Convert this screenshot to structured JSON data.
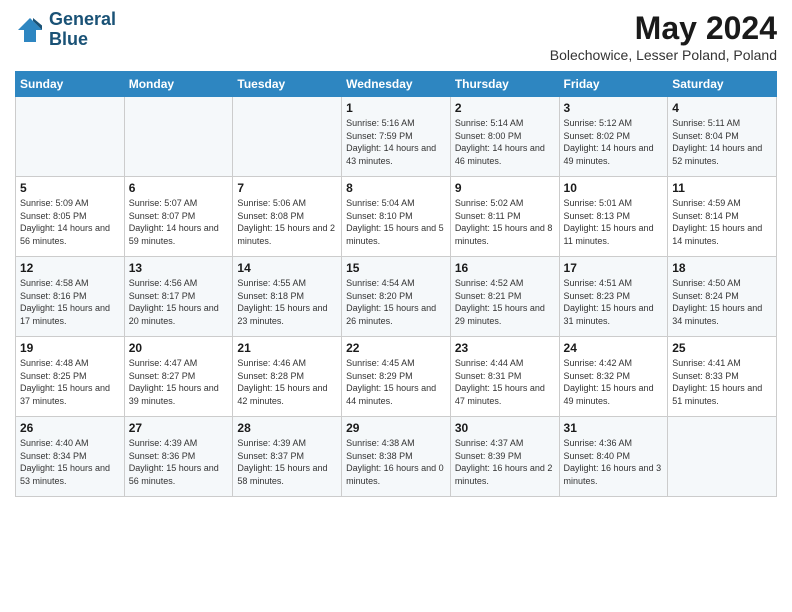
{
  "logo": {
    "line1": "General",
    "line2": "Blue"
  },
  "title": "May 2024",
  "location": "Bolechowice, Lesser Poland, Poland",
  "headers": [
    "Sunday",
    "Monday",
    "Tuesday",
    "Wednesday",
    "Thursday",
    "Friday",
    "Saturday"
  ],
  "weeks": [
    [
      {
        "day": "",
        "sunrise": "",
        "sunset": "",
        "daylight": ""
      },
      {
        "day": "",
        "sunrise": "",
        "sunset": "",
        "daylight": ""
      },
      {
        "day": "",
        "sunrise": "",
        "sunset": "",
        "daylight": ""
      },
      {
        "day": "1",
        "sunrise": "Sunrise: 5:16 AM",
        "sunset": "Sunset: 7:59 PM",
        "daylight": "Daylight: 14 hours and 43 minutes."
      },
      {
        "day": "2",
        "sunrise": "Sunrise: 5:14 AM",
        "sunset": "Sunset: 8:00 PM",
        "daylight": "Daylight: 14 hours and 46 minutes."
      },
      {
        "day": "3",
        "sunrise": "Sunrise: 5:12 AM",
        "sunset": "Sunset: 8:02 PM",
        "daylight": "Daylight: 14 hours and 49 minutes."
      },
      {
        "day": "4",
        "sunrise": "Sunrise: 5:11 AM",
        "sunset": "Sunset: 8:04 PM",
        "daylight": "Daylight: 14 hours and 52 minutes."
      }
    ],
    [
      {
        "day": "5",
        "sunrise": "Sunrise: 5:09 AM",
        "sunset": "Sunset: 8:05 PM",
        "daylight": "Daylight: 14 hours and 56 minutes."
      },
      {
        "day": "6",
        "sunrise": "Sunrise: 5:07 AM",
        "sunset": "Sunset: 8:07 PM",
        "daylight": "Daylight: 14 hours and 59 minutes."
      },
      {
        "day": "7",
        "sunrise": "Sunrise: 5:06 AM",
        "sunset": "Sunset: 8:08 PM",
        "daylight": "Daylight: 15 hours and 2 minutes."
      },
      {
        "day": "8",
        "sunrise": "Sunrise: 5:04 AM",
        "sunset": "Sunset: 8:10 PM",
        "daylight": "Daylight: 15 hours and 5 minutes."
      },
      {
        "day": "9",
        "sunrise": "Sunrise: 5:02 AM",
        "sunset": "Sunset: 8:11 PM",
        "daylight": "Daylight: 15 hours and 8 minutes."
      },
      {
        "day": "10",
        "sunrise": "Sunrise: 5:01 AM",
        "sunset": "Sunset: 8:13 PM",
        "daylight": "Daylight: 15 hours and 11 minutes."
      },
      {
        "day": "11",
        "sunrise": "Sunrise: 4:59 AM",
        "sunset": "Sunset: 8:14 PM",
        "daylight": "Daylight: 15 hours and 14 minutes."
      }
    ],
    [
      {
        "day": "12",
        "sunrise": "Sunrise: 4:58 AM",
        "sunset": "Sunset: 8:16 PM",
        "daylight": "Daylight: 15 hours and 17 minutes."
      },
      {
        "day": "13",
        "sunrise": "Sunrise: 4:56 AM",
        "sunset": "Sunset: 8:17 PM",
        "daylight": "Daylight: 15 hours and 20 minutes."
      },
      {
        "day": "14",
        "sunrise": "Sunrise: 4:55 AM",
        "sunset": "Sunset: 8:18 PM",
        "daylight": "Daylight: 15 hours and 23 minutes."
      },
      {
        "day": "15",
        "sunrise": "Sunrise: 4:54 AM",
        "sunset": "Sunset: 8:20 PM",
        "daylight": "Daylight: 15 hours and 26 minutes."
      },
      {
        "day": "16",
        "sunrise": "Sunrise: 4:52 AM",
        "sunset": "Sunset: 8:21 PM",
        "daylight": "Daylight: 15 hours and 29 minutes."
      },
      {
        "day": "17",
        "sunrise": "Sunrise: 4:51 AM",
        "sunset": "Sunset: 8:23 PM",
        "daylight": "Daylight: 15 hours and 31 minutes."
      },
      {
        "day": "18",
        "sunrise": "Sunrise: 4:50 AM",
        "sunset": "Sunset: 8:24 PM",
        "daylight": "Daylight: 15 hours and 34 minutes."
      }
    ],
    [
      {
        "day": "19",
        "sunrise": "Sunrise: 4:48 AM",
        "sunset": "Sunset: 8:25 PM",
        "daylight": "Daylight: 15 hours and 37 minutes."
      },
      {
        "day": "20",
        "sunrise": "Sunrise: 4:47 AM",
        "sunset": "Sunset: 8:27 PM",
        "daylight": "Daylight: 15 hours and 39 minutes."
      },
      {
        "day": "21",
        "sunrise": "Sunrise: 4:46 AM",
        "sunset": "Sunset: 8:28 PM",
        "daylight": "Daylight: 15 hours and 42 minutes."
      },
      {
        "day": "22",
        "sunrise": "Sunrise: 4:45 AM",
        "sunset": "Sunset: 8:29 PM",
        "daylight": "Daylight: 15 hours and 44 minutes."
      },
      {
        "day": "23",
        "sunrise": "Sunrise: 4:44 AM",
        "sunset": "Sunset: 8:31 PM",
        "daylight": "Daylight: 15 hours and 47 minutes."
      },
      {
        "day": "24",
        "sunrise": "Sunrise: 4:42 AM",
        "sunset": "Sunset: 8:32 PM",
        "daylight": "Daylight: 15 hours and 49 minutes."
      },
      {
        "day": "25",
        "sunrise": "Sunrise: 4:41 AM",
        "sunset": "Sunset: 8:33 PM",
        "daylight": "Daylight: 15 hours and 51 minutes."
      }
    ],
    [
      {
        "day": "26",
        "sunrise": "Sunrise: 4:40 AM",
        "sunset": "Sunset: 8:34 PM",
        "daylight": "Daylight: 15 hours and 53 minutes."
      },
      {
        "day": "27",
        "sunrise": "Sunrise: 4:39 AM",
        "sunset": "Sunset: 8:36 PM",
        "daylight": "Daylight: 15 hours and 56 minutes."
      },
      {
        "day": "28",
        "sunrise": "Sunrise: 4:39 AM",
        "sunset": "Sunset: 8:37 PM",
        "daylight": "Daylight: 15 hours and 58 minutes."
      },
      {
        "day": "29",
        "sunrise": "Sunrise: 4:38 AM",
        "sunset": "Sunset: 8:38 PM",
        "daylight": "Daylight: 16 hours and 0 minutes."
      },
      {
        "day": "30",
        "sunrise": "Sunrise: 4:37 AM",
        "sunset": "Sunset: 8:39 PM",
        "daylight": "Daylight: 16 hours and 2 minutes."
      },
      {
        "day": "31",
        "sunrise": "Sunrise: 4:36 AM",
        "sunset": "Sunset: 8:40 PM",
        "daylight": "Daylight: 16 hours and 3 minutes."
      },
      {
        "day": "",
        "sunrise": "",
        "sunset": "",
        "daylight": ""
      }
    ]
  ]
}
